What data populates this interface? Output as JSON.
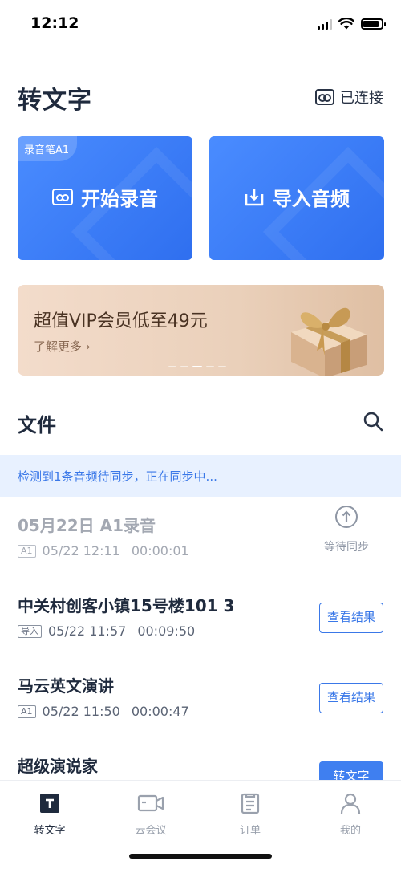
{
  "status_bar": {
    "time": "12:12",
    "battery_level": 0.85
  },
  "header": {
    "title": "转文字",
    "device_status": "已连接"
  },
  "cards": {
    "record": {
      "tag": "录音笔A1",
      "label": "开始录音"
    },
    "import": {
      "label": "导入音频"
    }
  },
  "banner": {
    "title": "超值VIP会员低至49元",
    "subtitle": "了解更多 ›",
    "pages": 5,
    "active_page": 2
  },
  "files": {
    "title": "文件",
    "sync_notice": "检测到1条音频待同步，正在同步中...",
    "items": [
      {
        "title": "05月22日 A1录音",
        "tag": "A1",
        "date": "05/22 12:11",
        "duration": "00:00:01",
        "status": "等待同步"
      },
      {
        "title": "中关村创客小镇15号楼101 3",
        "tag": "导入",
        "date": "05/22 11:57",
        "duration": "00:09:50",
        "action": "查看结果"
      },
      {
        "title": "马云英文演讲",
        "tag": "A1",
        "date": "05/22 11:50",
        "duration": "00:00:47",
        "action": "查看结果"
      },
      {
        "title": "超级演说家",
        "action": "转文字"
      }
    ]
  },
  "tabs": [
    {
      "label": "转文字",
      "icon": "transcribe-icon",
      "active": true
    },
    {
      "label": "云会议",
      "icon": "video-meeting-icon",
      "active": false
    },
    {
      "label": "订单",
      "icon": "order-list-icon",
      "active": false
    },
    {
      "label": "我的",
      "icon": "person-icon",
      "active": false
    }
  ],
  "colors": {
    "accent": "#3a78e8",
    "text": "#1f2a3d",
    "sync_bg": "#e8f1ff"
  }
}
